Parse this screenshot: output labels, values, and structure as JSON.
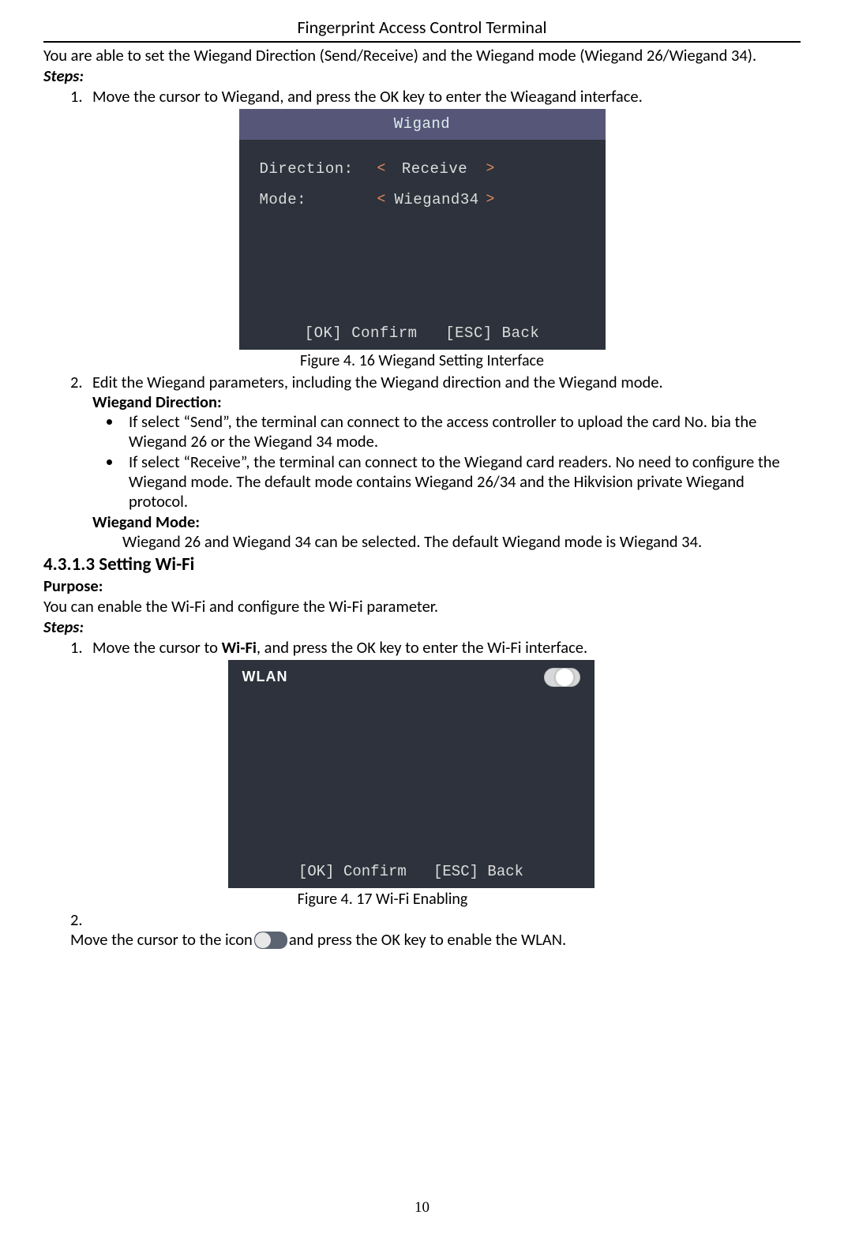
{
  "header": "Fingerprint Access Control Terminal",
  "intro": "You are able to set the Wiegand Direction (Send/Receive) and the Wiegand mode (Wiegand 26/Wiegand 34).",
  "steps_label": "Steps:",
  "step1_num": "1.",
  "step1": "Move the cursor to Wiegand, and press the OK key to enter the Wieagand interface.",
  "fig1": {
    "title": "Wigand",
    "row1_label": "Direction:",
    "row1_value": "Receive",
    "row2_label": "Mode:",
    "row2_value": "Wiegand34",
    "footer_ok": "[OK] Confirm",
    "footer_esc": "[ESC] Back",
    "arrow_left": "<",
    "arrow_right": ">"
  },
  "fig1_caption": "Figure 4. 16 Wiegand Setting Interface",
  "step2_num": "2.",
  "step2": "Edit the Wiegand parameters, including the Wiegand direction and the Wiegand mode.",
  "wd_label": "Wiegand Direction:",
  "wd_b1": "If select “Send”, the terminal can connect to the access controller to upload the card No. bia the Wiegand 26 or the Wiegand 34 mode.",
  "wd_b2": "If select “Receive”, the terminal can connect to the Wiegand card readers. No need to configure the Wiegand mode. The default mode contains Wiegand 26/34 and the Hikvision private Wiegand protocol.",
  "wm_label": "Wiegand Mode:",
  "wm_body": "Wiegand 26 and Wiegand 34 can be selected. The default Wiegand mode is Wiegand 34.",
  "section": "4.3.1.3 Setting Wi-Fi",
  "purpose_label": "Purpose:",
  "purpose_body": "You can enable the Wi-Fi and configure the Wi-Fi parameter.",
  "steps2_label": "Steps:",
  "wifi_step1_num": "1.",
  "wifi_step1_a": "Move the cursor to ",
  "wifi_step1_wifi": "Wi-Fi",
  "wifi_step1_b": ", and press the OK key to enter the Wi-Fi interface.",
  "fig2": {
    "label": "WLAN",
    "footer_ok": "[OK] Confirm",
    "footer_esc": "[ESC] Back"
  },
  "fig2_caption": "Figure 4. 17 Wi-Fi Enabling",
  "wifi_step2_num": "2.",
  "wifi_step2_a": "Move the cursor to the icon ",
  "wifi_step2_b": " and press the OK key to enable the WLAN.",
  "page_num": "10"
}
